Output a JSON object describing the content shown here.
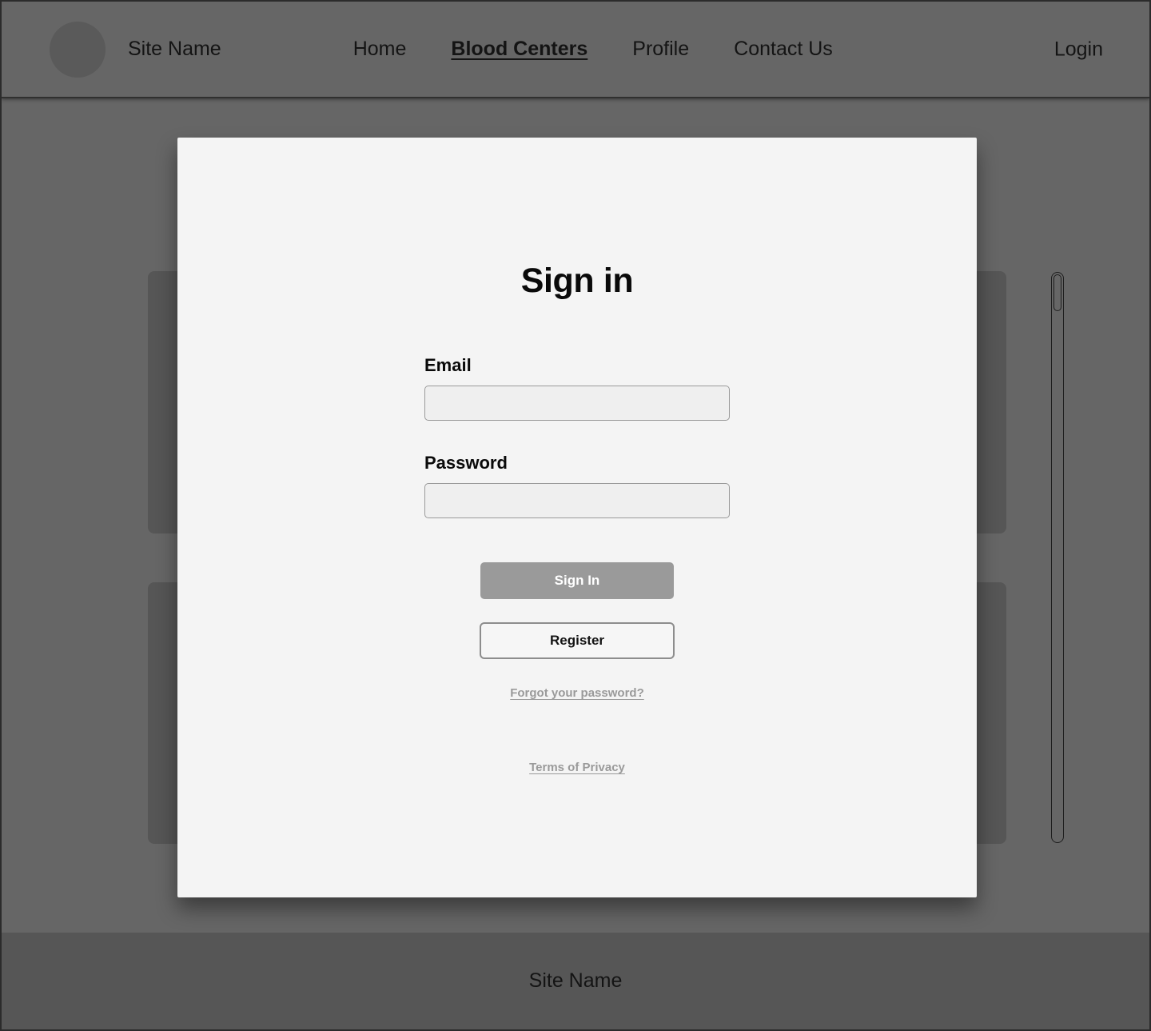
{
  "header": {
    "logo_icon": "circle-avatar-icon",
    "brand_name": "Site Name",
    "nav": [
      {
        "label": "Home",
        "active": false
      },
      {
        "label": "Blood Centers",
        "active": true
      },
      {
        "label": "Profile",
        "active": false
      },
      {
        "label": "Contact Us",
        "active": false
      }
    ],
    "login_label": "Login",
    "background": "#666666"
  },
  "background_content": {
    "cards": [
      {
        "name": "blood-center-card-1"
      },
      {
        "name": "blood-center-card-2"
      }
    ],
    "scrollbar": {
      "name": "list-scrollbar",
      "thumb_position": "top"
    }
  },
  "modal": {
    "title": "Sign in",
    "email": {
      "label": "Email",
      "value": "",
      "placeholder": ""
    },
    "password": {
      "label": "Password",
      "value": "",
      "placeholder": ""
    },
    "sign_in_label": "Sign In",
    "register_label": "Register",
    "forgot_password_label": "Forgot your password?",
    "terms_label": "Terms of Privacy",
    "colors": {
      "surface": "#f4f4f4",
      "primary_button": "#9a9a9a",
      "link": "#9a9a9a",
      "input_fill": "#efefef",
      "input_border": "#9a9a9a"
    }
  },
  "footer": {
    "site_name": "Site Name",
    "background": "#565656"
  }
}
